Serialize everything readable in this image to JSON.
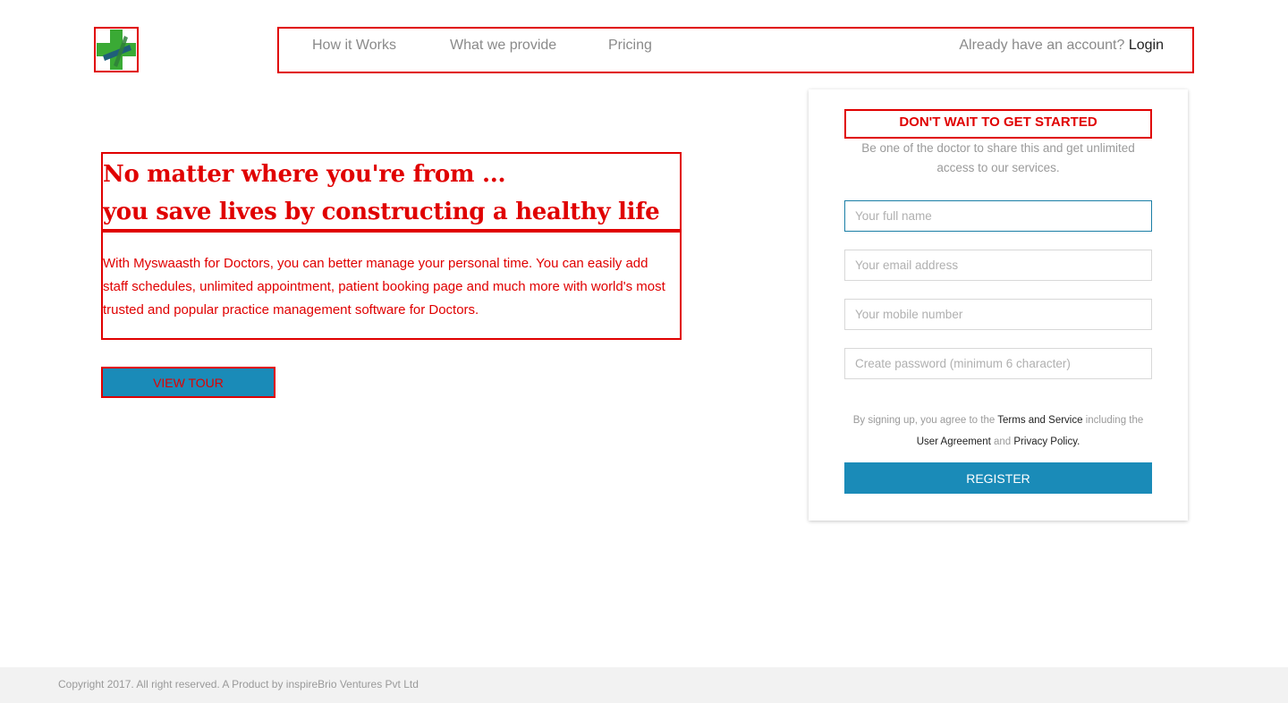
{
  "header": {
    "logo_icon": "green-cross-logo-icon",
    "nav": [
      {
        "label": "How it Works"
      },
      {
        "label": "What we provide"
      },
      {
        "label": "Pricing"
      }
    ],
    "account_prompt": "Already have an account?",
    "login_label": "Login"
  },
  "hero": {
    "title_line1": "No matter where you're from ...",
    "title_line2": "you save lives by constructing a healthy life",
    "description": "With Myswaasth for Doctors, you can better manage your personal time. You can easily add staff schedules, unlimited appointment, patient booking page and much more with world's most trusted and popular practice management software for Doctors.",
    "tour_button": "VIEW TOUR"
  },
  "signup": {
    "heading": "DON'T WAIT TO GET STARTED",
    "subheading": "Be one of the doctor to share this and get unlimited access to our services.",
    "fields": {
      "full_name": {
        "placeholder": "Your full name",
        "value": ""
      },
      "email": {
        "placeholder": "Your email address",
        "value": ""
      },
      "mobile": {
        "placeholder": "Your mobile number",
        "value": ""
      },
      "password": {
        "placeholder": "Create password (minimum 6 character)",
        "value": ""
      }
    },
    "terms": {
      "prefix": "By signing up, you agree to the",
      "terms_link": "Terms and Service",
      "middle": "including the",
      "agreement_link": "User Agreement",
      "and": "and",
      "privacy_link": "Privacy Policy."
    },
    "register_button": "REGISTER"
  },
  "footer": {
    "copyright": "Copyright 2017. All right reserved. A Product by inspireBrio Ventures Pvt Ltd"
  },
  "colors": {
    "accent": "#1a8bb8",
    "outline_red": "#e00000",
    "footer_bg": "#f2f2f2"
  }
}
